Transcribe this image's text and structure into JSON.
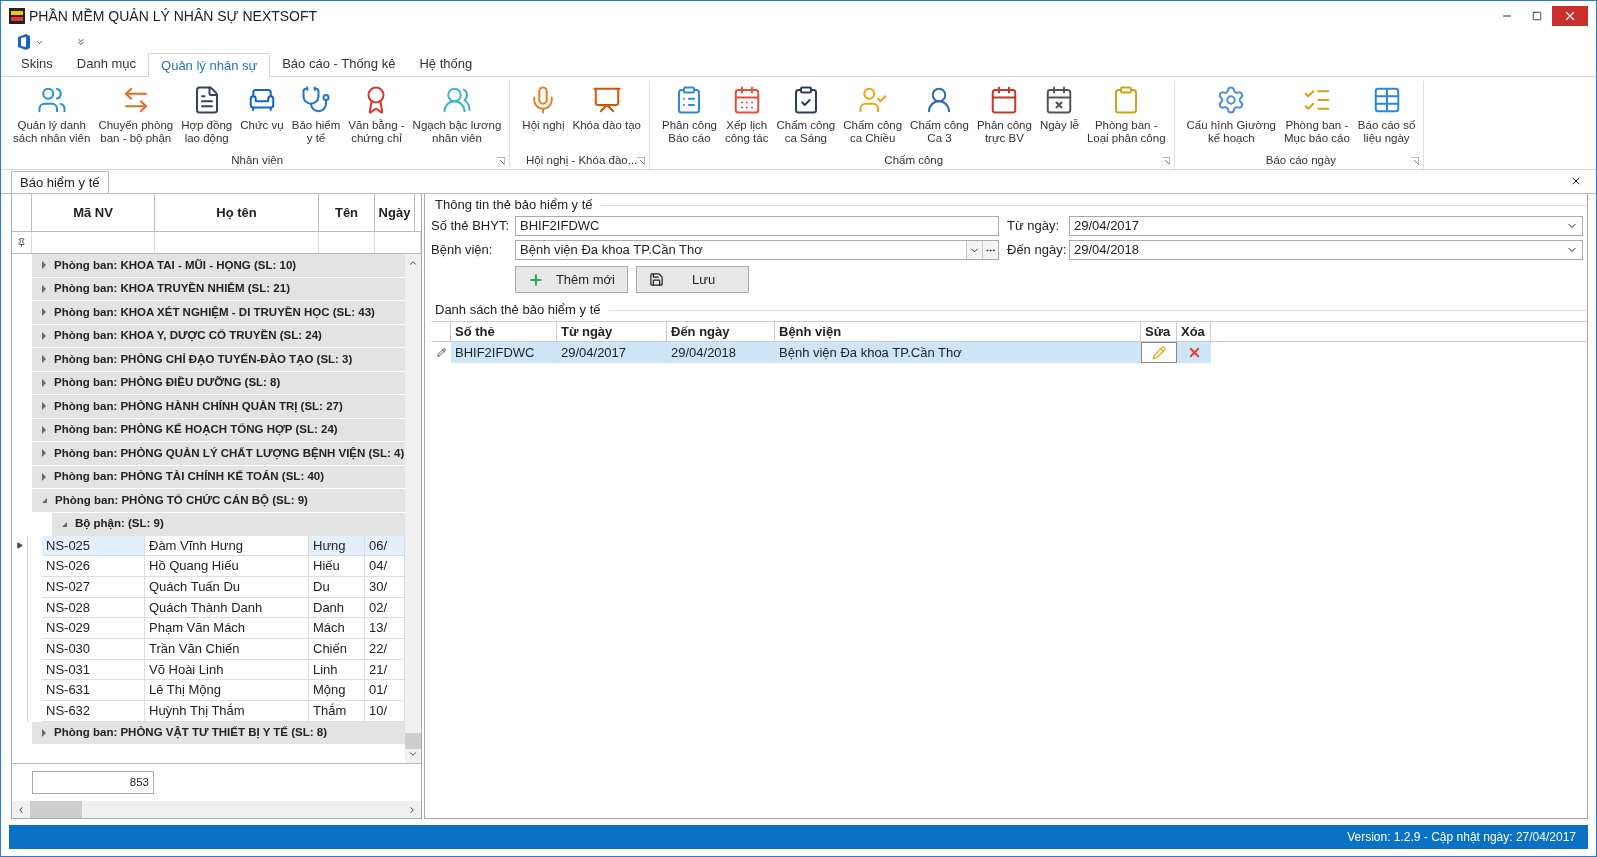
{
  "window": {
    "title": "PHẦN MỀM QUẢN LÝ NHÂN SỰ NEXTSOFT"
  },
  "ribbon": {
    "tabs": [
      {
        "label": "Skins",
        "selected": false
      },
      {
        "label": "Danh mục",
        "selected": false
      },
      {
        "label": "Quản lý nhân sự",
        "selected": true
      },
      {
        "label": "Báo cáo - Thống kê",
        "selected": false
      },
      {
        "label": "Hệ thống",
        "selected": false
      }
    ],
    "groups": [
      {
        "title": "Nhân viên",
        "items": [
          "Quản lý danh\nsách nhân viên",
          "Chuyển phòng\nban - bộ phận",
          "Hợp đồng\nlao động",
          "Chức vụ",
          "Bảo hiểm\ny tế",
          "Văn bằng -\nchứng chỉ",
          "Ngạch bậc lương\nnhân viên"
        ]
      },
      {
        "title": "Hội nghị - Khóa đào...",
        "items": [
          "Hội nghị",
          "Khóa đào tạo"
        ]
      },
      {
        "title": "Chấm công",
        "items": [
          "Phân công\nBáo cáo",
          "Xếp lịch\ncông tác",
          "Chấm công\nca Sáng",
          "Chấm công\nca Chiều",
          "Chấm công\nCa 3",
          "Phân công\ntrực BV",
          "Ngày lễ",
          "Phòng ban -\nLoại phân công"
        ]
      },
      {
        "title": "Báo cáo ngày",
        "items": [
          "Cấu hình Giường\nkế hoạch",
          "Phòng ban -\nMục báo cáo",
          "Báo cáo số\nliệu ngày"
        ]
      }
    ]
  },
  "document_tab": {
    "label": "Báo hiểm y tế"
  },
  "employee_grid": {
    "columns": [
      "Mã NV",
      "Họ tên",
      "Tên",
      "Ngày"
    ],
    "groups": [
      {
        "label": "Phòng ban: KHOA TAI - MŨI - HỌNG (SL: 10)",
        "expanded": false
      },
      {
        "label": "Phòng ban: KHOA TRUYỀN NHIỄM (SL: 21)",
        "expanded": false
      },
      {
        "label": "Phòng ban: KHOA XÉT NGHIỆM - DI TRUYỀN HỌC (SL: 43)",
        "expanded": false
      },
      {
        "label": "Phòng ban: KHOA Y, DƯỢC CỔ TRUYỀN (SL: 24)",
        "expanded": false
      },
      {
        "label": "Phòng ban: PHÒNG CHỈ ĐẠO TUYẾN-ĐÀO TẠO (SL: 3)",
        "expanded": false
      },
      {
        "label": "Phòng ban: PHÒNG ĐIỀU DƯỠNG (SL: 8)",
        "expanded": false
      },
      {
        "label": "Phòng ban: PHÒNG HÀNH CHÍNH QUẢN TRỊ (SL: 27)",
        "expanded": false
      },
      {
        "label": "Phòng ban: PHÒNG KẾ HOẠCH TỔNG HỢP (SL: 24)",
        "expanded": false
      },
      {
        "label": "Phòng ban: PHÒNG QUẢN LÝ CHẤT LƯỢNG BỆNH VIỆN (SL: 4)",
        "expanded": false
      },
      {
        "label": "Phòng ban: PHÒNG TÀI CHÍNH KẾ TOÁN (SL: 40)",
        "expanded": false
      },
      {
        "label": "Phòng ban: PHÒNG TỔ CHỨC CÁN BỘ (SL: 9)",
        "expanded": true,
        "children": [
          {
            "label": "Bộ phận:  (SL: 9)",
            "expanded": true,
            "rows": [
              {
                "cells": [
                  "NS-025",
                  "Đàm Vĩnh Hưng",
                  "Hưng",
                  "06/"
                ],
                "selected": true
              },
              {
                "cells": [
                  "NS-026",
                  "Hồ Quang Hiếu",
                  "Hiếu",
                  "04/"
                ],
                "selected": false
              },
              {
                "cells": [
                  "NS-027",
                  "Quách Tuấn Du",
                  "Du",
                  "30/"
                ],
                "selected": false
              },
              {
                "cells": [
                  "NS-028",
                  "Quách Thành Danh",
                  "Danh",
                  "02/"
                ],
                "selected": false
              },
              {
                "cells": [
                  "NS-029",
                  "Phạm Văn Mách",
                  "Mách",
                  "13/"
                ],
                "selected": false
              },
              {
                "cells": [
                  "NS-030",
                  "Trần Văn Chiến",
                  "Chiến",
                  "22/"
                ],
                "selected": false
              },
              {
                "cells": [
                  "NS-031",
                  "Võ Hoài Linh",
                  "Linh",
                  "21/"
                ],
                "selected": false
              },
              {
                "cells": [
                  "NS-631",
                  "Lê Thị Mộng",
                  "Mộng",
                  "01/"
                ],
                "selected": false
              },
              {
                "cells": [
                  "NS-632",
                  "Huỳnh Thị Thắm",
                  "Thắm",
                  "10/"
                ],
                "selected": false
              }
            ]
          }
        ]
      },
      {
        "label": "Phòng ban: PHÒNG VẬT TƯ THIẾT BỊ Y TẾ (SL: 8)",
        "expanded": false
      }
    ],
    "total": "853"
  },
  "card_info": {
    "title": "Thông tin thẻ bảo hiểm y tế",
    "card_number": {
      "label": "Số thẻ BHYT:",
      "value": "BHIF2IFDWC"
    },
    "from_date": {
      "label": "Từ ngày:",
      "value": "29/04/2017"
    },
    "hospital": {
      "label": "Bệnh viện:",
      "value": "Bệnh viện Đa khoa TP.Cần Thơ"
    },
    "to_date": {
      "label": "Đến ngày:",
      "value": "29/04/2018"
    },
    "buttons": [
      {
        "kind": "add",
        "label": "Thêm mới"
      },
      {
        "kind": "save",
        "label": "Lưu"
      }
    ]
  },
  "card_list": {
    "title": "Danh sách thẻ bảo hiểm y tế",
    "columns": [
      "Số thẻ",
      "Từ ngày",
      "Đến ngày",
      "Bệnh viện",
      "Sửa",
      "Xóa"
    ],
    "rows": [
      {
        "cells": [
          "BHIF2IFDWC",
          "29/04/2017",
          "29/04/2018",
          "Bệnh viện Đa khoa TP.Cần Thơ"
        ],
        "selected": true
      }
    ]
  },
  "status_bar": {
    "text": "Version: 1.2.9 - Cập nhật ngày: 27/04/2017"
  }
}
